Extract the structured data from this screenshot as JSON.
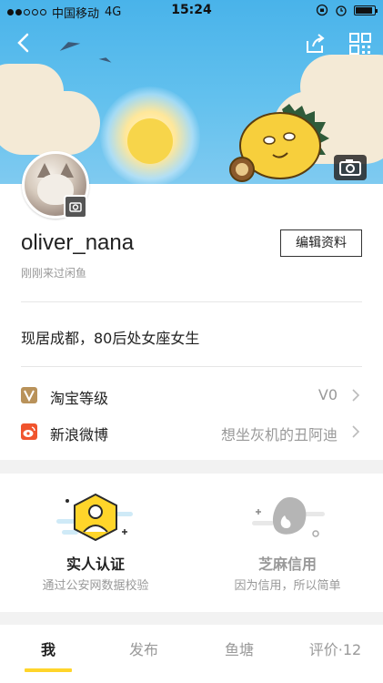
{
  "status_bar": {
    "carrier": "中国移动",
    "network": "4G",
    "time": "15:24"
  },
  "profile": {
    "username": "oliver_nana",
    "last_visit": "刚刚来过闲鱼",
    "edit_label": "编辑资料",
    "bio": "现居成都，80后处女座女生"
  },
  "rows": [
    {
      "label": "淘宝等级",
      "value": "V0",
      "icon": "taobao-level-icon",
      "color": "#b9925a"
    },
    {
      "label": "新浪微博",
      "value": "想坐灰机的丑阿迪",
      "icon": "weibo-icon",
      "color": "#f0542d"
    }
  ],
  "verify": [
    {
      "title": "实人认证",
      "subtitle": "通过公安网数据校验",
      "icon": "real-person-icon",
      "color": "#ffd52a"
    },
    {
      "title": "芝麻信用",
      "subtitle": "因为信用，所以简单",
      "icon": "sesame-credit-icon",
      "color": "#b5b5b5"
    }
  ],
  "tabs": [
    {
      "label": "我",
      "active": true
    },
    {
      "label": "发布",
      "active": false
    },
    {
      "label": "鱼塘",
      "active": false
    },
    {
      "label": "评价·12",
      "active": false
    }
  ],
  "colors": {
    "accent": "#ffd52a",
    "banner_sky": "#49b3ea"
  }
}
